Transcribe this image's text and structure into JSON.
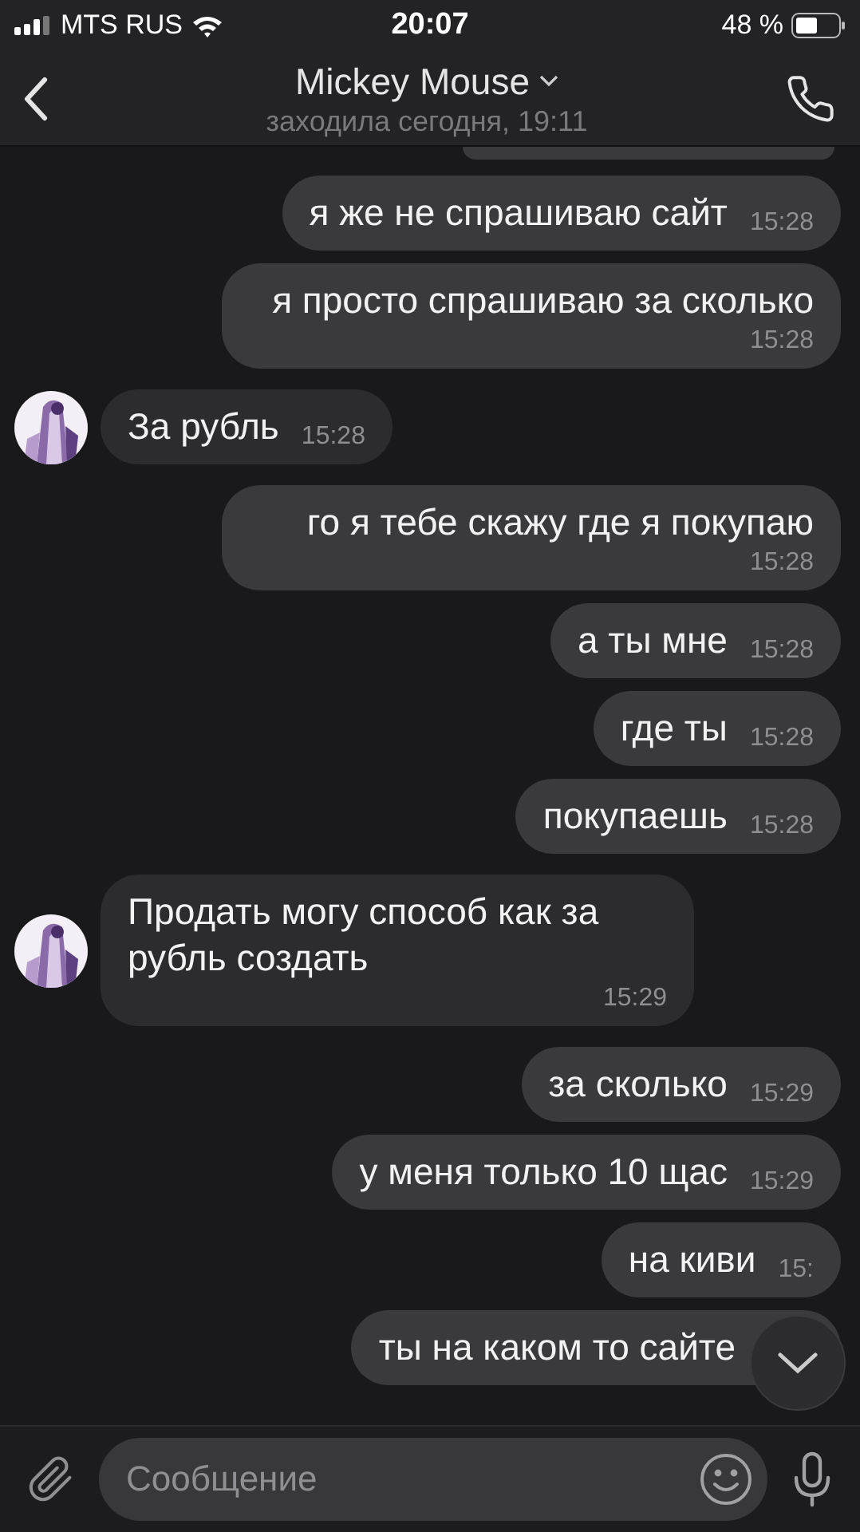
{
  "status_bar": {
    "carrier": "MTS RUS",
    "time": "20:07",
    "battery": "48 %"
  },
  "header": {
    "title": "Mickey Mouse",
    "subtitle": "заходила сегодня, 19:11"
  },
  "messages": [
    {
      "kind": "outgoing",
      "text": "я же не спрашиваю сайт",
      "time": "15:28"
    },
    {
      "kind": "outgoing",
      "text": "я просто спрашиваю за сколько",
      "time": "15:28"
    },
    {
      "kind": "incoming",
      "text": "За рубль",
      "time": "15:28"
    },
    {
      "kind": "outgoing",
      "text": "го я тебе скажу где я покупаю",
      "time": "15:28"
    },
    {
      "kind": "outgoing",
      "text": "а ты мне",
      "time": "15:28"
    },
    {
      "kind": "outgoing",
      "text": "где ты",
      "time": "15:28"
    },
    {
      "kind": "outgoing",
      "text": "покупаешь",
      "time": "15:28"
    },
    {
      "kind": "incoming",
      "text": "Продать могу способ как за рубль создать",
      "time": "15:29"
    },
    {
      "kind": "outgoing",
      "text": "за сколько",
      "time": "15:29"
    },
    {
      "kind": "outgoing",
      "text": "у меня только 10 щас",
      "time": "15:29"
    },
    {
      "kind": "outgoing",
      "text": "на киви",
      "time": "15:"
    },
    {
      "kind": "outgoing",
      "text": "ты на каком то сайте"
    }
  ],
  "composer": {
    "placeholder": "Сообщение"
  }
}
